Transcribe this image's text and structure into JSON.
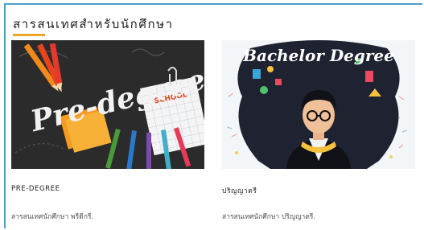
{
  "section": {
    "heading": "สารสนเทศสำหรับนักศึกษา"
  },
  "cards": [
    {
      "image_text": "Pre-degree",
      "sticker_text": "SCHOOL",
      "title": "PRE-DEGREE",
      "description": "สารสนเทศนักศึกษา พรีดีกรี."
    },
    {
      "image_text": "Bachelor Degree",
      "title": "ปริญญาตรี",
      "description": "สารสนเทศนักศึกษา ปริญญาตรี."
    }
  ],
  "colors": {
    "accent": "#f0a52b",
    "frame": "#4aa0c8",
    "chalkboard": "#2b2b2b"
  }
}
